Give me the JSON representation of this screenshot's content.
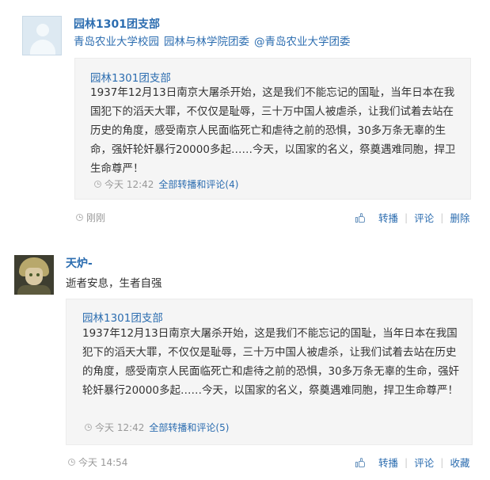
{
  "feed": {
    "posts": [
      {
        "author": "园林1301团支部",
        "content_links": [
          "青岛农业大学校园",
          "园林与林学院团委",
          "@青岛农业大学团委"
        ],
        "repost": {
          "author": "园林1301团支部",
          "text": "1937年12月13日南京大屠杀开始，这是我们不能忘记的国耻，当年日本在我国犯下的滔天大罪，不仅仅是耻辱，三十万中国人被虐杀，让我们试着去站在历史的角度，感受南京人民面临死亡和虐待之前的恐惧，30多万条无辜的生命，强奸轮奸暴行20000多起……今天，以国家的名义，祭奠遇难同胞，捍卫生命尊严！",
          "time": "今天 12:42",
          "forward_label": "全部转播和评论(4)"
        },
        "time": "刚刚",
        "actions": {
          "repost": "转播",
          "comment": "评论",
          "last": "删除"
        }
      },
      {
        "author": "天炉-",
        "content": "逝者安息，生者自强",
        "repost": {
          "author": "园林1301团支部",
          "text": "1937年12月13日南京大屠杀开始，这是我们不能忘记的国耻，当年日本在我国犯下的滔天大罪，不仅仅是耻辱，三十万中国人被虐杀，让我们试着去站在历史的角度，感受南京人民面临死亡和虐待之前的恐惧，30多万条无辜的生命，强奸轮奸暴行20000多起……今天，以国家的名义，祭奠遇难同胞，捍卫生命尊严！",
          "time": "今天 12:42",
          "forward_label": "全部转播和评论(5)"
        },
        "time": "今天 14:54",
        "actions": {
          "repost": "转播",
          "comment": "评论",
          "last": "收藏"
        }
      }
    ]
  },
  "icons": {
    "avatar_placeholder": "default-user-avatar",
    "avatar_user": "anime-character-avatar",
    "time": "clock-icon",
    "like": "thumbs-up-icon"
  },
  "colors": {
    "link": "#2c6db0",
    "text": "#333333",
    "meta": "#999999",
    "repost_bg": "#f5f5f5"
  }
}
